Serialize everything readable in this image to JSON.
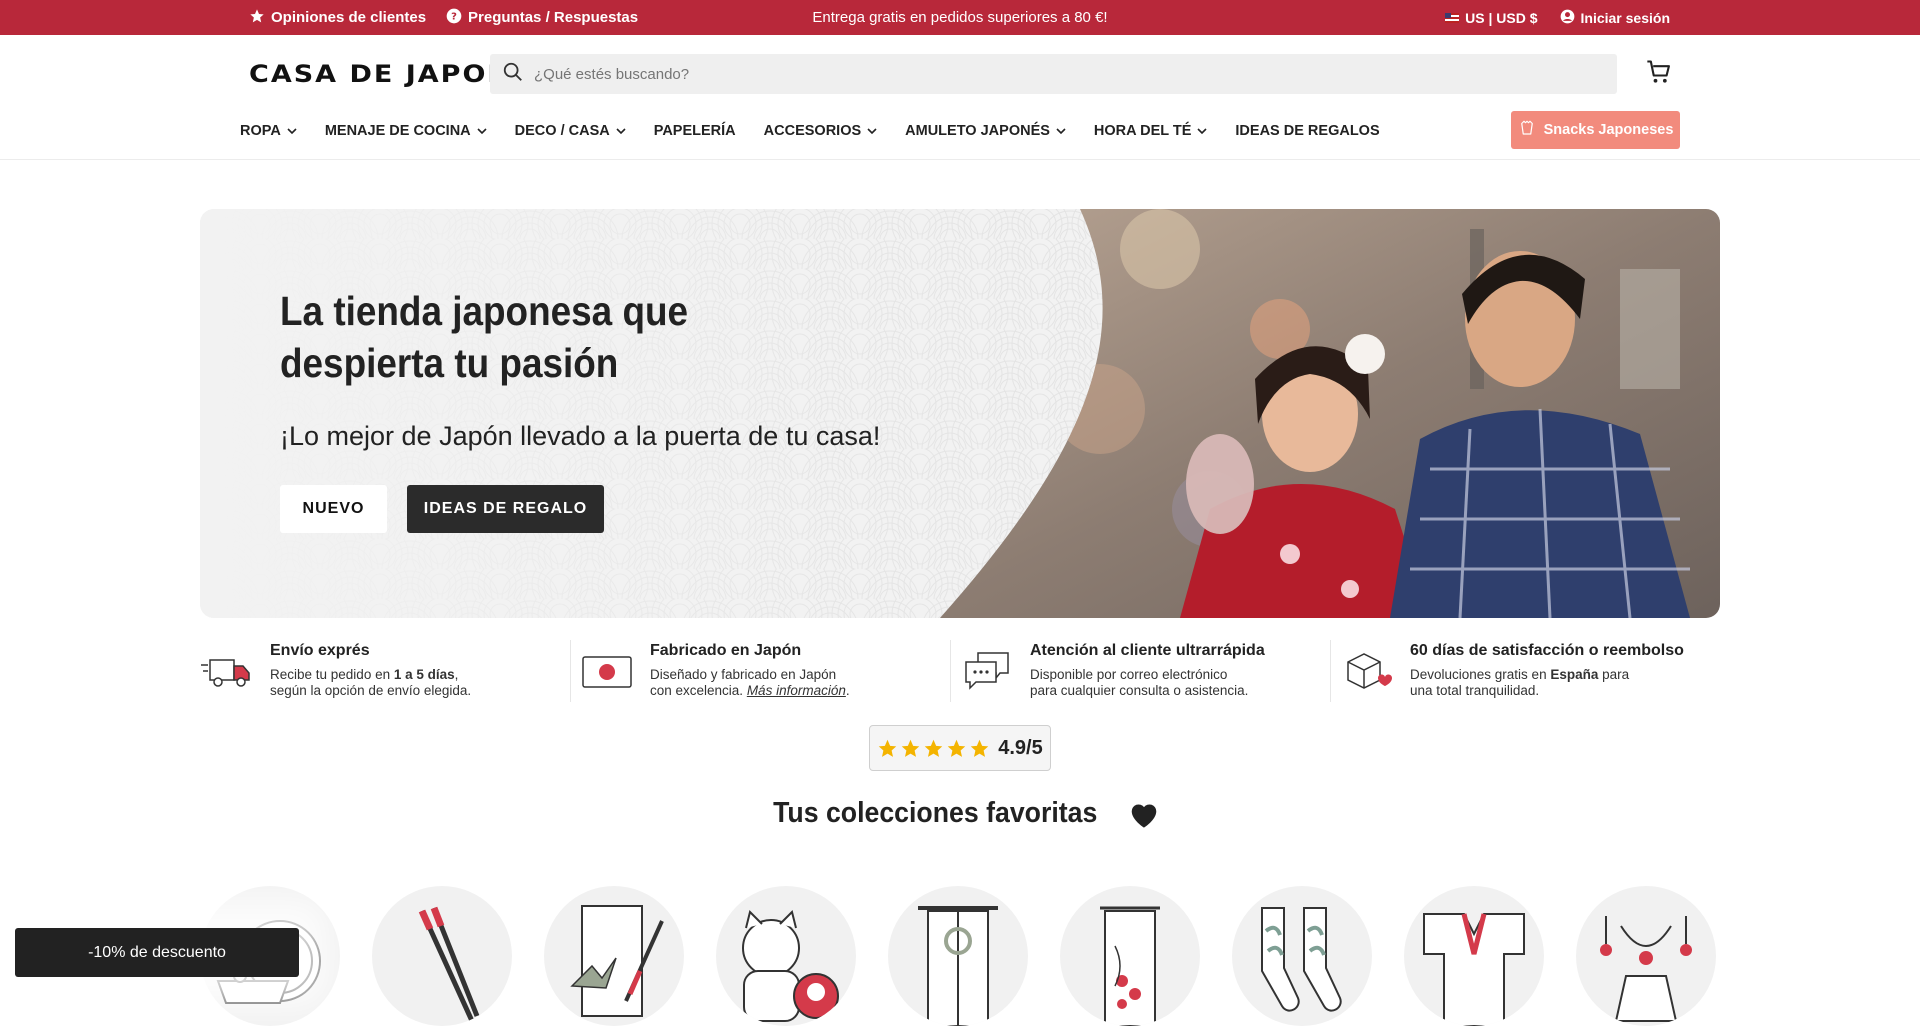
{
  "topbar": {
    "reviews": "Opiniones de clientes",
    "faq": "Preguntas / Respuestas",
    "shipping_promo": "Entrega gratis en pedidos superiores a 80 €!",
    "locale": "US | USD $",
    "login": "Iniciar sesión",
    "bg_color": "#b8283a"
  },
  "header": {
    "logo": "CASA DE JAPON",
    "search_placeholder": "¿Qué estés buscando?",
    "cart_icon": "cart-icon"
  },
  "nav": {
    "items": [
      {
        "label": "ROPA",
        "dropdown": true
      },
      {
        "label": "MENAJE DE COCINA",
        "dropdown": true
      },
      {
        "label": "DECO / CASA",
        "dropdown": true
      },
      {
        "label": "PAPELERÍA",
        "dropdown": false
      },
      {
        "label": "ACCESORIOS",
        "dropdown": true
      },
      {
        "label": "AMULETO JAPONÉS",
        "dropdown": true
      },
      {
        "label": "HORA DEL TÉ",
        "dropdown": true
      },
      {
        "label": "IDEAS DE REGALOS",
        "dropdown": false
      }
    ],
    "snacks": "Snacks Japoneses",
    "snacks_color": "#f28b7d"
  },
  "hero": {
    "title": "La tienda japonesa que despierta tu pasión",
    "subtitle": "¡Lo mejor de Japón llevado a la puerta de tu casa!",
    "btn_new": "NUEVO",
    "btn_gift": "IDEAS DE REGALO"
  },
  "features": [
    {
      "title": "Envío exprés",
      "line1_pre": "Recibe tu pedido en ",
      "line1_bold": "1 a 5 días",
      "line1_post": ",",
      "line2": "según la opción de envío elegida.",
      "icon": "delivery-truck-icon"
    },
    {
      "title": "Fabricado en Japón",
      "line1": "Diseñado y fabricado en Japón",
      "line2_pre": "con excelencia. ",
      "line2_link": "Más información",
      "line2_post": ".",
      "icon": "japan-flag-icon"
    },
    {
      "title": "Atención al cliente ultrarrápida",
      "line1": "Disponible por correo electrónico",
      "line2": "para cualquier consulta o asistencia.",
      "icon": "chat-bubbles-icon"
    },
    {
      "title": "60 días de satisfacción o reembolso",
      "line1_pre": "Devoluciones gratis en ",
      "line1_bold": "España",
      "line1_post": " para",
      "line2": "una total tranquilidad.",
      "icon": "return-box-icon"
    }
  ],
  "rating": {
    "score": "4.9/5",
    "stars": 5
  },
  "collections_title": "Tus colecciones favoritas",
  "collections": [
    "bento-icon",
    "chopsticks-icon",
    "origami-icon",
    "maneki-neko-icon",
    "noren-icon",
    "tapestry-icon",
    "socks-icon",
    "kimono-icon",
    "jewelry-icon"
  ],
  "discount": "-10% de descuento"
}
